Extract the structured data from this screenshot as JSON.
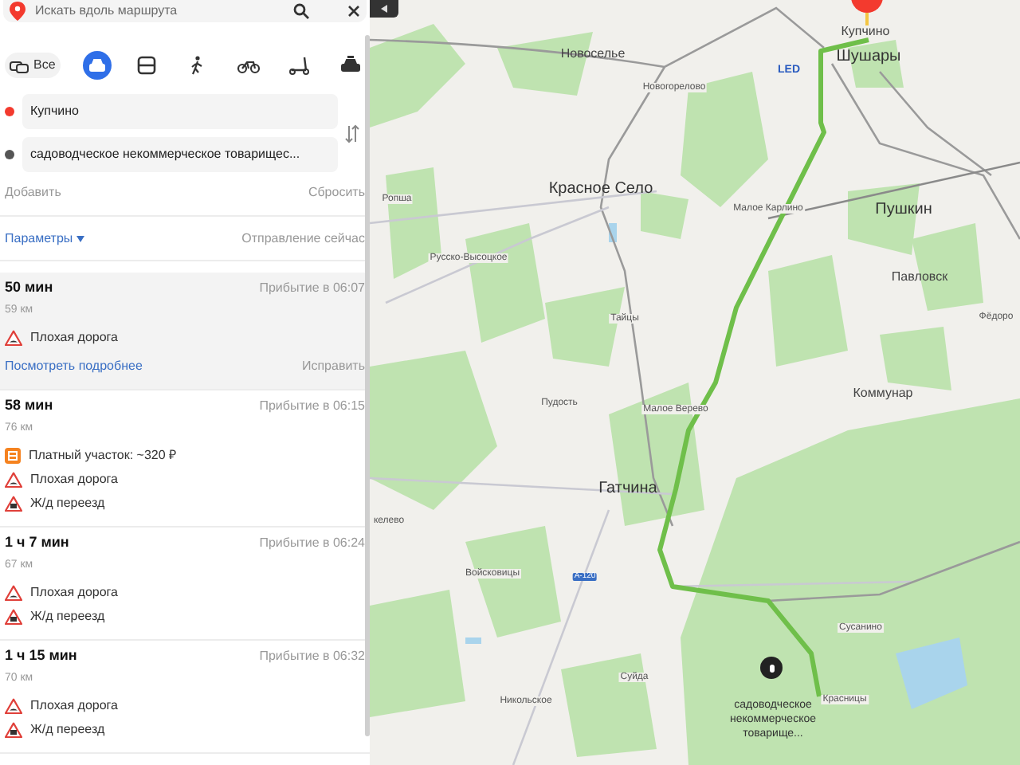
{
  "search": {
    "placeholder": "Искать вдоль маршрута"
  },
  "modes": [
    {
      "kind": "all",
      "label": "Все",
      "selected": false
    },
    {
      "kind": "car",
      "selected": true
    },
    {
      "kind": "bus",
      "selected": false
    },
    {
      "kind": "walk",
      "selected": false
    },
    {
      "kind": "bike",
      "selected": false
    },
    {
      "kind": "scooter",
      "selected": false
    },
    {
      "kind": "taxi",
      "selected": false
    }
  ],
  "waypoints": [
    {
      "value": "Купчино",
      "color": "#f33a2e"
    },
    {
      "value": "садоводческое некоммерческое товарищес...",
      "color": "#555555"
    }
  ],
  "add_label": "Добавить",
  "reset_label": "Сбросить",
  "params_label": "Параметры",
  "departure": "Отправление сейчас",
  "routes": [
    {
      "duration": "50 мин",
      "arrival": "Прибытие в 06:07",
      "distance": "59 км",
      "selected": true,
      "notes": [
        {
          "kind": "bad_road",
          "text": "Плохая дорога"
        }
      ],
      "details_link": "Посмотреть подробнее",
      "fix_label": "Исправить"
    },
    {
      "duration": "58 мин",
      "arrival": "Прибытие в 06:15",
      "distance": "76 км",
      "selected": false,
      "notes": [
        {
          "kind": "toll",
          "text": "Платный участок: ~320 ₽"
        },
        {
          "kind": "bad_road",
          "text": "Плохая дорога"
        },
        {
          "kind": "rail_crossing",
          "text": "Ж/д переезд"
        }
      ]
    },
    {
      "duration": "1 ч 7 мин",
      "arrival": "Прибытие в 06:24",
      "distance": "67 км",
      "selected": false,
      "notes": [
        {
          "kind": "bad_road",
          "text": "Плохая дорога"
        },
        {
          "kind": "rail_crossing",
          "text": "Ж/д переезд"
        }
      ]
    },
    {
      "duration": "1 ч 15 мин",
      "arrival": "Прибытие в 06:32",
      "distance": "70 км",
      "selected": false,
      "notes": [
        {
          "kind": "bad_road",
          "text": "Плохая дорога"
        },
        {
          "kind": "rail_crossing",
          "text": "Ж/д переезд"
        }
      ]
    }
  ],
  "map": {
    "labels": [
      {
        "text": "Новоселье",
        "kind": "village"
      },
      {
        "text": "Новогорелово",
        "kind": "small"
      },
      {
        "text": "LED",
        "kind": "airport"
      },
      {
        "text": "Купчино",
        "kind": "village"
      },
      {
        "text": "Шушары",
        "kind": "city"
      },
      {
        "text": "Красное Село",
        "kind": "city"
      },
      {
        "text": "Ропша",
        "kind": "small"
      },
      {
        "text": "Малое Карлино",
        "kind": "small"
      },
      {
        "text": "Пушкин",
        "kind": "city"
      },
      {
        "text": "Русско-Высоцкое",
        "kind": "small"
      },
      {
        "text": "Павловск",
        "kind": "village"
      },
      {
        "text": "Тайцы",
        "kind": "small"
      },
      {
        "text": "Фёдоро",
        "kind": "small"
      },
      {
        "text": "Пудость",
        "kind": "small"
      },
      {
        "text": "Малое Верево",
        "kind": "small"
      },
      {
        "text": "Коммунар",
        "kind": "village"
      },
      {
        "text": "Гатчина",
        "kind": "city"
      },
      {
        "text": "келево",
        "kind": "small"
      },
      {
        "text": "Войсковицы",
        "kind": "small"
      },
      {
        "text": "А-120",
        "kind": "road_sign"
      },
      {
        "text": "Сусанино",
        "kind": "small"
      },
      {
        "text": "Суйда",
        "kind": "small"
      },
      {
        "text": "Никольское",
        "kind": "small"
      },
      {
        "text": "Красницы",
        "kind": "small"
      }
    ],
    "destination_label": "садоводческое некоммерческое товарище..."
  }
}
